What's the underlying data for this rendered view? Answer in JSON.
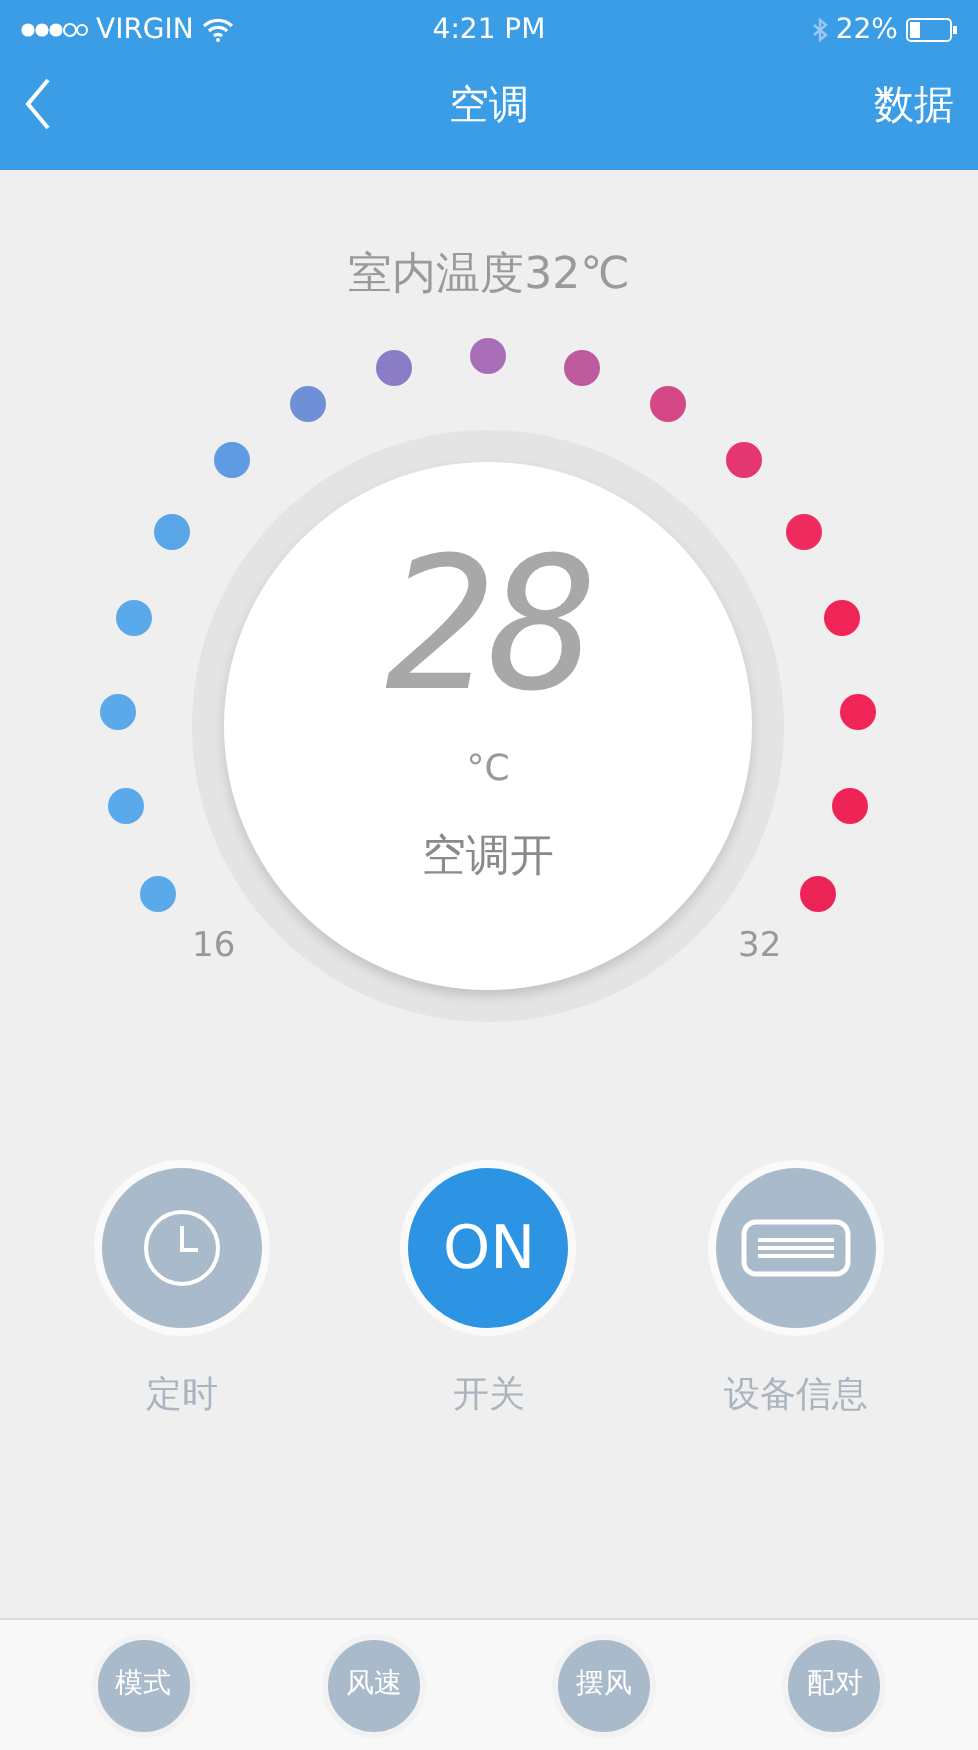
{
  "status_bar": {
    "carrier": "VIRGIN",
    "time": "4:21 PM",
    "battery": "22%"
  },
  "nav": {
    "title": "空调",
    "action": "数据"
  },
  "indoor_temp": "室内温度32℃",
  "dial": {
    "value": "28",
    "unit": "°C",
    "status": "空调开",
    "min": "16",
    "max": "32",
    "dots": [
      {
        "color": "#5aa9ea"
      },
      {
        "color": "#5aa9ea"
      },
      {
        "color": "#5aa9ea"
      },
      {
        "color": "#5aa9ea"
      },
      {
        "color": "#5aa5e8"
      },
      {
        "color": "#5f9be2"
      },
      {
        "color": "#6f8fd6"
      },
      {
        "color": "#8a7cc6"
      },
      {
        "color": "#a86eb8"
      },
      {
        "color": "#c05a9e"
      },
      {
        "color": "#d44888"
      },
      {
        "color": "#e43670"
      },
      {
        "color": "#ee2a5e"
      },
      {
        "color": "#f02456"
      },
      {
        "color": "#f02456"
      },
      {
        "color": "#ee2456"
      },
      {
        "color": "#ec2456"
      }
    ]
  },
  "controls": [
    {
      "kind": "timer",
      "label": "定时"
    },
    {
      "kind": "power",
      "label": "开关",
      "text": "ON",
      "on": true
    },
    {
      "kind": "device",
      "label": "设备信息"
    }
  ],
  "tab_bar": [
    "模式",
    "风速",
    "摆风",
    "配对"
  ]
}
